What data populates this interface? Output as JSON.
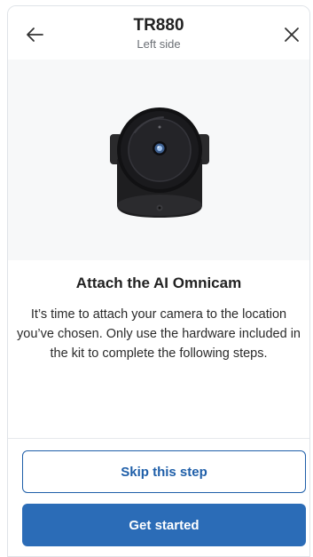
{
  "header": {
    "title": "TR880",
    "subtitle": "Left side",
    "back_icon": "arrow-left-icon",
    "close_icon": "close-icon"
  },
  "content": {
    "heading": "Attach the AI Omnicam",
    "body": "It’s time to attach your camera to the location you’ve chosen. Only use the hardware included in the kit to complete the following steps."
  },
  "actions": {
    "skip_label": "Skip this step",
    "start_label": "Get started"
  },
  "colors": {
    "primary": "#2b6cb7",
    "outline": "#1f5fa9",
    "hero_bg": "#f7f8f9"
  }
}
